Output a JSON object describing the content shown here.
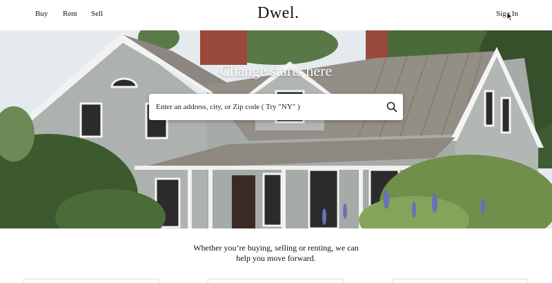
{
  "nav": {
    "buy": "Buy",
    "rent": "Rent",
    "sell": "Sell",
    "logo": "Dwel.",
    "sign_in": "Sign In"
  },
  "hero": {
    "title": "Change starts here",
    "search_placeholder": "Enter an address, city, or Zip code ( Try \"NY\" )",
    "search_icon": "search-icon"
  },
  "tagline": {
    "line1": "Whether you’re buying, selling or renting, we can",
    "line2": "help you move forward."
  },
  "colors": {
    "header_bg": "#ffffff",
    "hero_text": "#ffffff",
    "siding": "#a9aea9",
    "roof": "#8f8a82",
    "chimney": "#9a4a3a",
    "foliage": "#3d5a2e"
  }
}
